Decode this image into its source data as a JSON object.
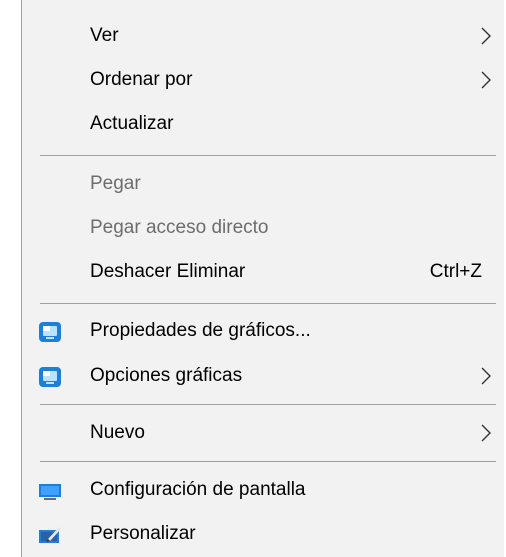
{
  "menu": {
    "items": [
      {
        "label": "Ver",
        "submenu": true
      },
      {
        "label": "Ordenar por",
        "submenu": true
      },
      {
        "label": "Actualizar"
      },
      {
        "label": "Pegar",
        "disabled": true
      },
      {
        "label": "Pegar acceso directo",
        "disabled": true
      },
      {
        "label": "Deshacer Eliminar",
        "shortcut": "Ctrl+Z"
      },
      {
        "label": "Propiedades de gráficos...",
        "icon": "graphics-icon"
      },
      {
        "label": "Opciones gráficas",
        "icon": "graphics-icon",
        "submenu": true
      },
      {
        "label": "Nuevo",
        "submenu": true
      },
      {
        "label": "Configuración de pantalla",
        "icon": "display-icon"
      },
      {
        "label": "Personalizar",
        "icon": "personalize-icon"
      }
    ]
  },
  "colors": {
    "menu_background": "#f2f2f2",
    "separator": "#a0a0a0",
    "disabled_text": "#6d6d6d",
    "icon_blue": "#1e7fd6"
  }
}
